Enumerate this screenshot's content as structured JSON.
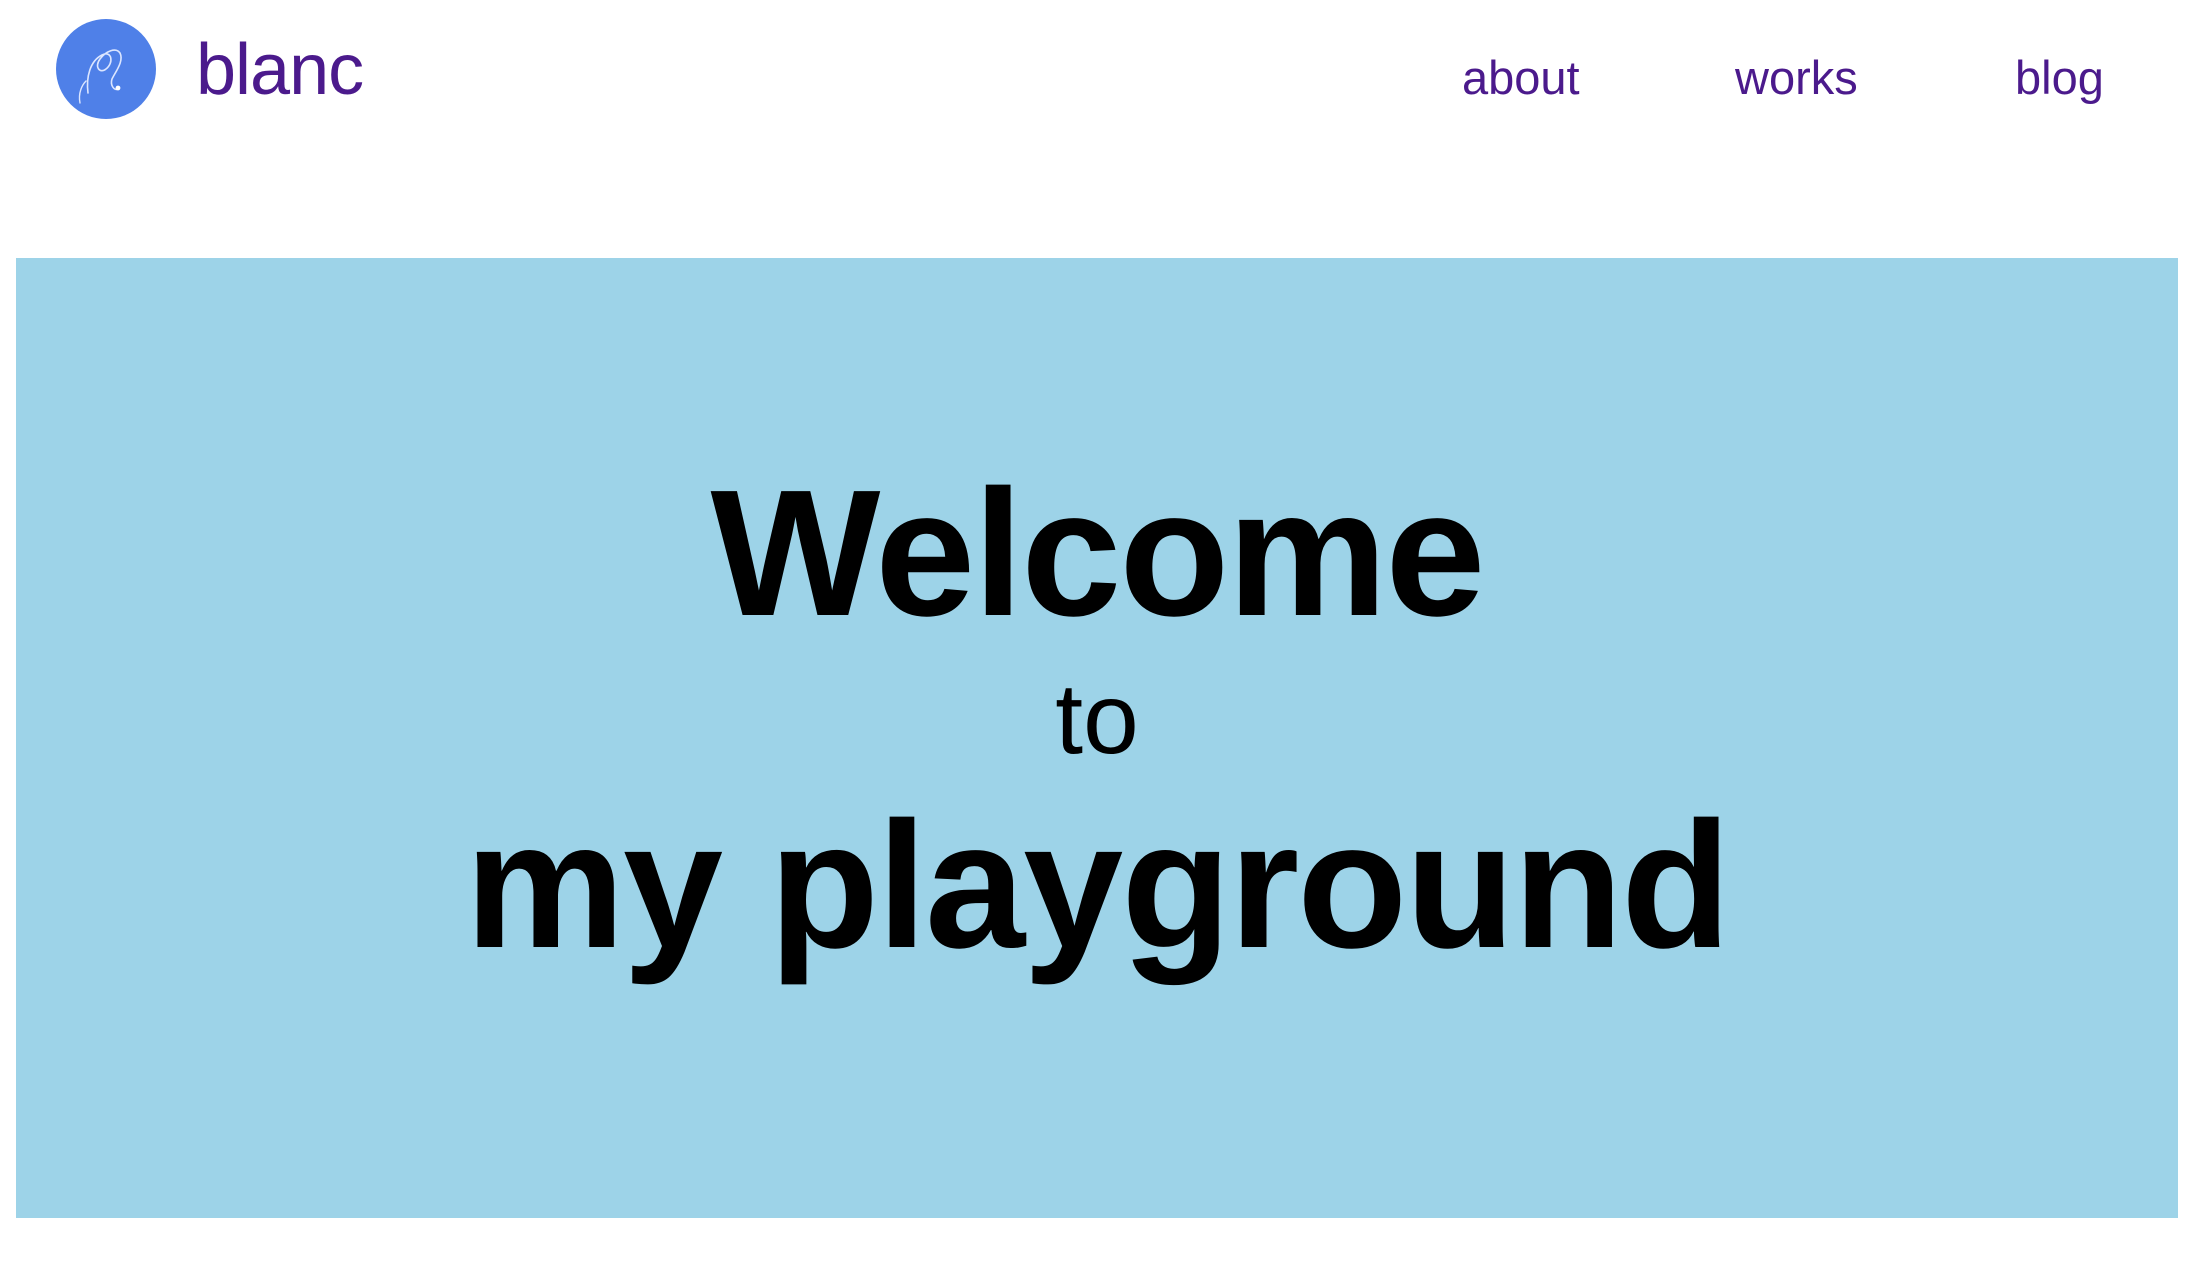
{
  "header": {
    "logo_icon": "squiggle-logo-icon",
    "brand": "blanc",
    "nav": {
      "about": "about",
      "works": "works",
      "blog": "blog"
    }
  },
  "hero": {
    "line1": "Welcome",
    "line2": "to",
    "line3": "my playground"
  },
  "colors": {
    "brand_text": "#4b1a8c",
    "logo_bg": "#4f80e8",
    "hero_bg": "#9dd3e8",
    "hero_text": "#000000",
    "page_bg": "#ffffff"
  }
}
